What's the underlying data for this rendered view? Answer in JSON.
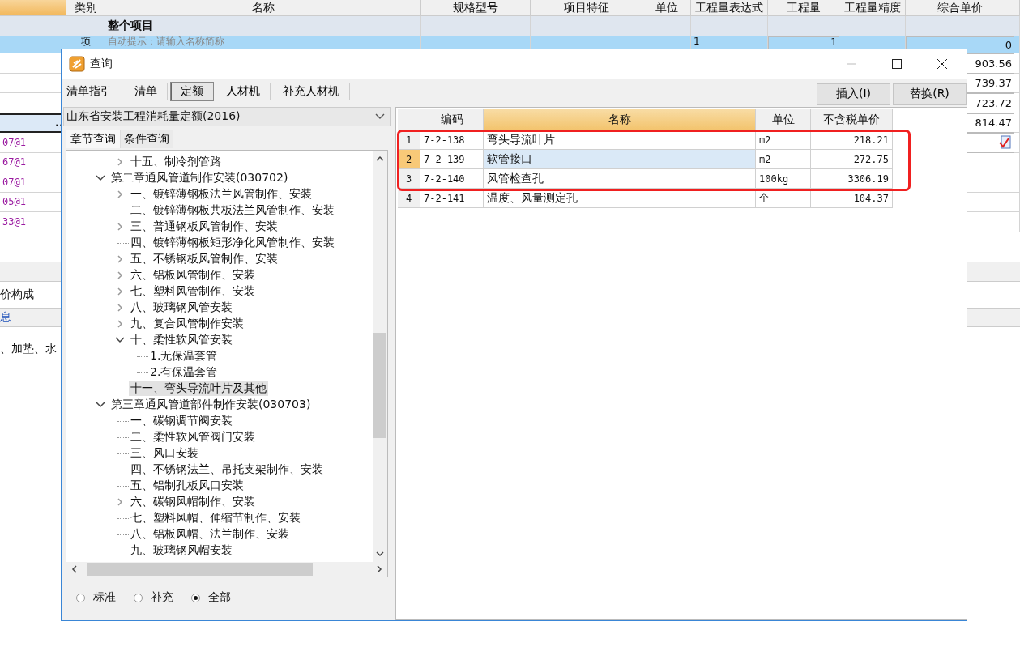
{
  "sheet": {
    "columns": [
      "类别",
      "名称",
      "规格型号",
      "项目特征",
      "单位",
      "工程量表达式",
      "工程量",
      "工程量精度",
      "综合单价"
    ],
    "rows": [
      {
        "kind": "group",
        "name": "整个项目"
      },
      {
        "kind": "item",
        "selected": true,
        "type": "项",
        "name": "自动提示：请输入名称简称",
        "expression": "1",
        "quantity": "1",
        "price": "0"
      },
      {
        "kind": "line",
        "price": "903.56"
      },
      {
        "kind": "line",
        "price": "739.37"
      },
      {
        "kind": "line",
        "price": "723.72"
      },
      {
        "kind": "field",
        "button": "..",
        "price": "814.47"
      },
      {
        "kind": "line",
        "code": "07@1",
        "note_icon": true
      },
      {
        "kind": "line",
        "code": "67@1"
      },
      {
        "kind": "line",
        "code": "07@1"
      },
      {
        "kind": "line",
        "code": "05@1"
      },
      {
        "kind": "line",
        "code": "33@1"
      }
    ],
    "lower_tab": "价构成",
    "info_tab": "息",
    "detail": "、加垫、水"
  },
  "dialog": {
    "title": "查询",
    "tabs": [
      {
        "label": "清单指引",
        "selected": false
      },
      {
        "label": "清单",
        "selected": false
      },
      {
        "label": "定额",
        "selected": true
      },
      {
        "label": "人材机",
        "selected": false
      },
      {
        "label": "补充人材机",
        "selected": false
      }
    ],
    "buttons": [
      "插入(I)",
      "替换(R)"
    ],
    "library": "山东省安装工程消耗量定额(2016)",
    "subtabs": [
      {
        "label": "章节查询",
        "selected": true
      },
      {
        "label": "条件查询",
        "selected": false
      }
    ],
    "tree": [
      {
        "children": [
          {
            "kind": "branch",
            "expanded": false,
            "selected": false,
            "label": "十五、制冷剂管路"
          }
        ]
      },
      {
        "kind": "branch",
        "expanded": true,
        "selected": false,
        "label": "第二章通风管道制作安装(030702)",
        "children": [
          {
            "kind": "branch",
            "expanded": false,
            "selected": false,
            "label": "一、镀锌薄钢板法兰风管制作、安装"
          },
          {
            "kind": "leaf",
            "selected": false,
            "label": "二、镀锌薄钢板共板法兰风管制作、安装"
          },
          {
            "kind": "branch",
            "expanded": false,
            "selected": false,
            "label": "三、普通钢板风管制作、安装"
          },
          {
            "kind": "leaf",
            "selected": false,
            "label": "四、镀锌薄钢板矩形净化风管制作、安装"
          },
          {
            "kind": "branch",
            "expanded": false,
            "selected": false,
            "label": "五、不锈钢板风管制作、安装"
          },
          {
            "kind": "branch",
            "expanded": false,
            "selected": false,
            "label": "六、铝板风管制作、安装"
          },
          {
            "kind": "branch",
            "expanded": false,
            "selected": false,
            "label": "七、塑料风管制作、安装"
          },
          {
            "kind": "branch",
            "expanded": false,
            "selected": false,
            "label": "八、玻璃钢风管安装"
          },
          {
            "kind": "branch",
            "expanded": false,
            "selected": false,
            "label": "九、复合风管制作安装"
          },
          {
            "kind": "branch",
            "expanded": true,
            "selected": false,
            "label": "十、柔性软风管安装",
            "children": [
              {
                "kind": "leaf",
                "selected": false,
                "label": "1.无保温套管"
              },
              {
                "kind": "leaf",
                "selected": false,
                "label": "2.有保温套管"
              }
            ]
          },
          {
            "kind": "leaf",
            "selected": true,
            "label": "十一、弯头导流叶片及其他"
          }
        ]
      },
      {
        "kind": "branch",
        "expanded": true,
        "selected": false,
        "label": "第三章通风管道部件制作安装(030703)",
        "children": [
          {
            "kind": "leaf",
            "selected": false,
            "label": "一、碳钢调节阀安装"
          },
          {
            "kind": "leaf",
            "selected": false,
            "label": "二、柔性软风管阀门安装"
          },
          {
            "kind": "leaf",
            "selected": false,
            "label": "三、风口安装"
          },
          {
            "kind": "leaf",
            "selected": false,
            "label": "四、不锈钢法兰、吊托支架制作、安装"
          },
          {
            "kind": "leaf",
            "selected": false,
            "label": "五、铝制孔板风口安装"
          },
          {
            "kind": "branch",
            "expanded": false,
            "selected": false,
            "label": "六、碳钢风帽制作、安装"
          },
          {
            "kind": "leaf",
            "selected": false,
            "label": "七、塑料风帽、伸缩节制作、安装"
          },
          {
            "kind": "leaf",
            "selected": false,
            "label": "八、铝板风帽、法兰制作、安装"
          },
          {
            "kind": "leaf",
            "selected": false,
            "label": "九、玻璃钢风帽安装"
          }
        ]
      }
    ],
    "filters": [
      {
        "label": "标准",
        "selected": false
      },
      {
        "label": "补充",
        "selected": false
      },
      {
        "label": "全部",
        "selected": true
      }
    ],
    "table": {
      "columns": [
        "编码",
        "名称",
        "单位",
        "不含税单价"
      ],
      "rows": [
        {
          "index": "1",
          "code": "7-2-138",
          "name": "弯头导流叶片",
          "unit": "m2",
          "price": "218.21",
          "selected": false
        },
        {
          "index": "2",
          "code": "7-2-139",
          "name": "软管接口",
          "unit": "m2",
          "price": "272.75",
          "selected": true
        },
        {
          "index": "3",
          "code": "7-2-140",
          "name": "风管检查孔",
          "unit": "100kg",
          "price": "3306.19",
          "selected": false
        },
        {
          "index": "4",
          "code": "7-2-141",
          "name": "温度、风量测定孔",
          "unit": "个",
          "price": "104.37",
          "selected": false
        }
      ]
    },
    "annotation": {
      "kind": "box"
    }
  }
}
